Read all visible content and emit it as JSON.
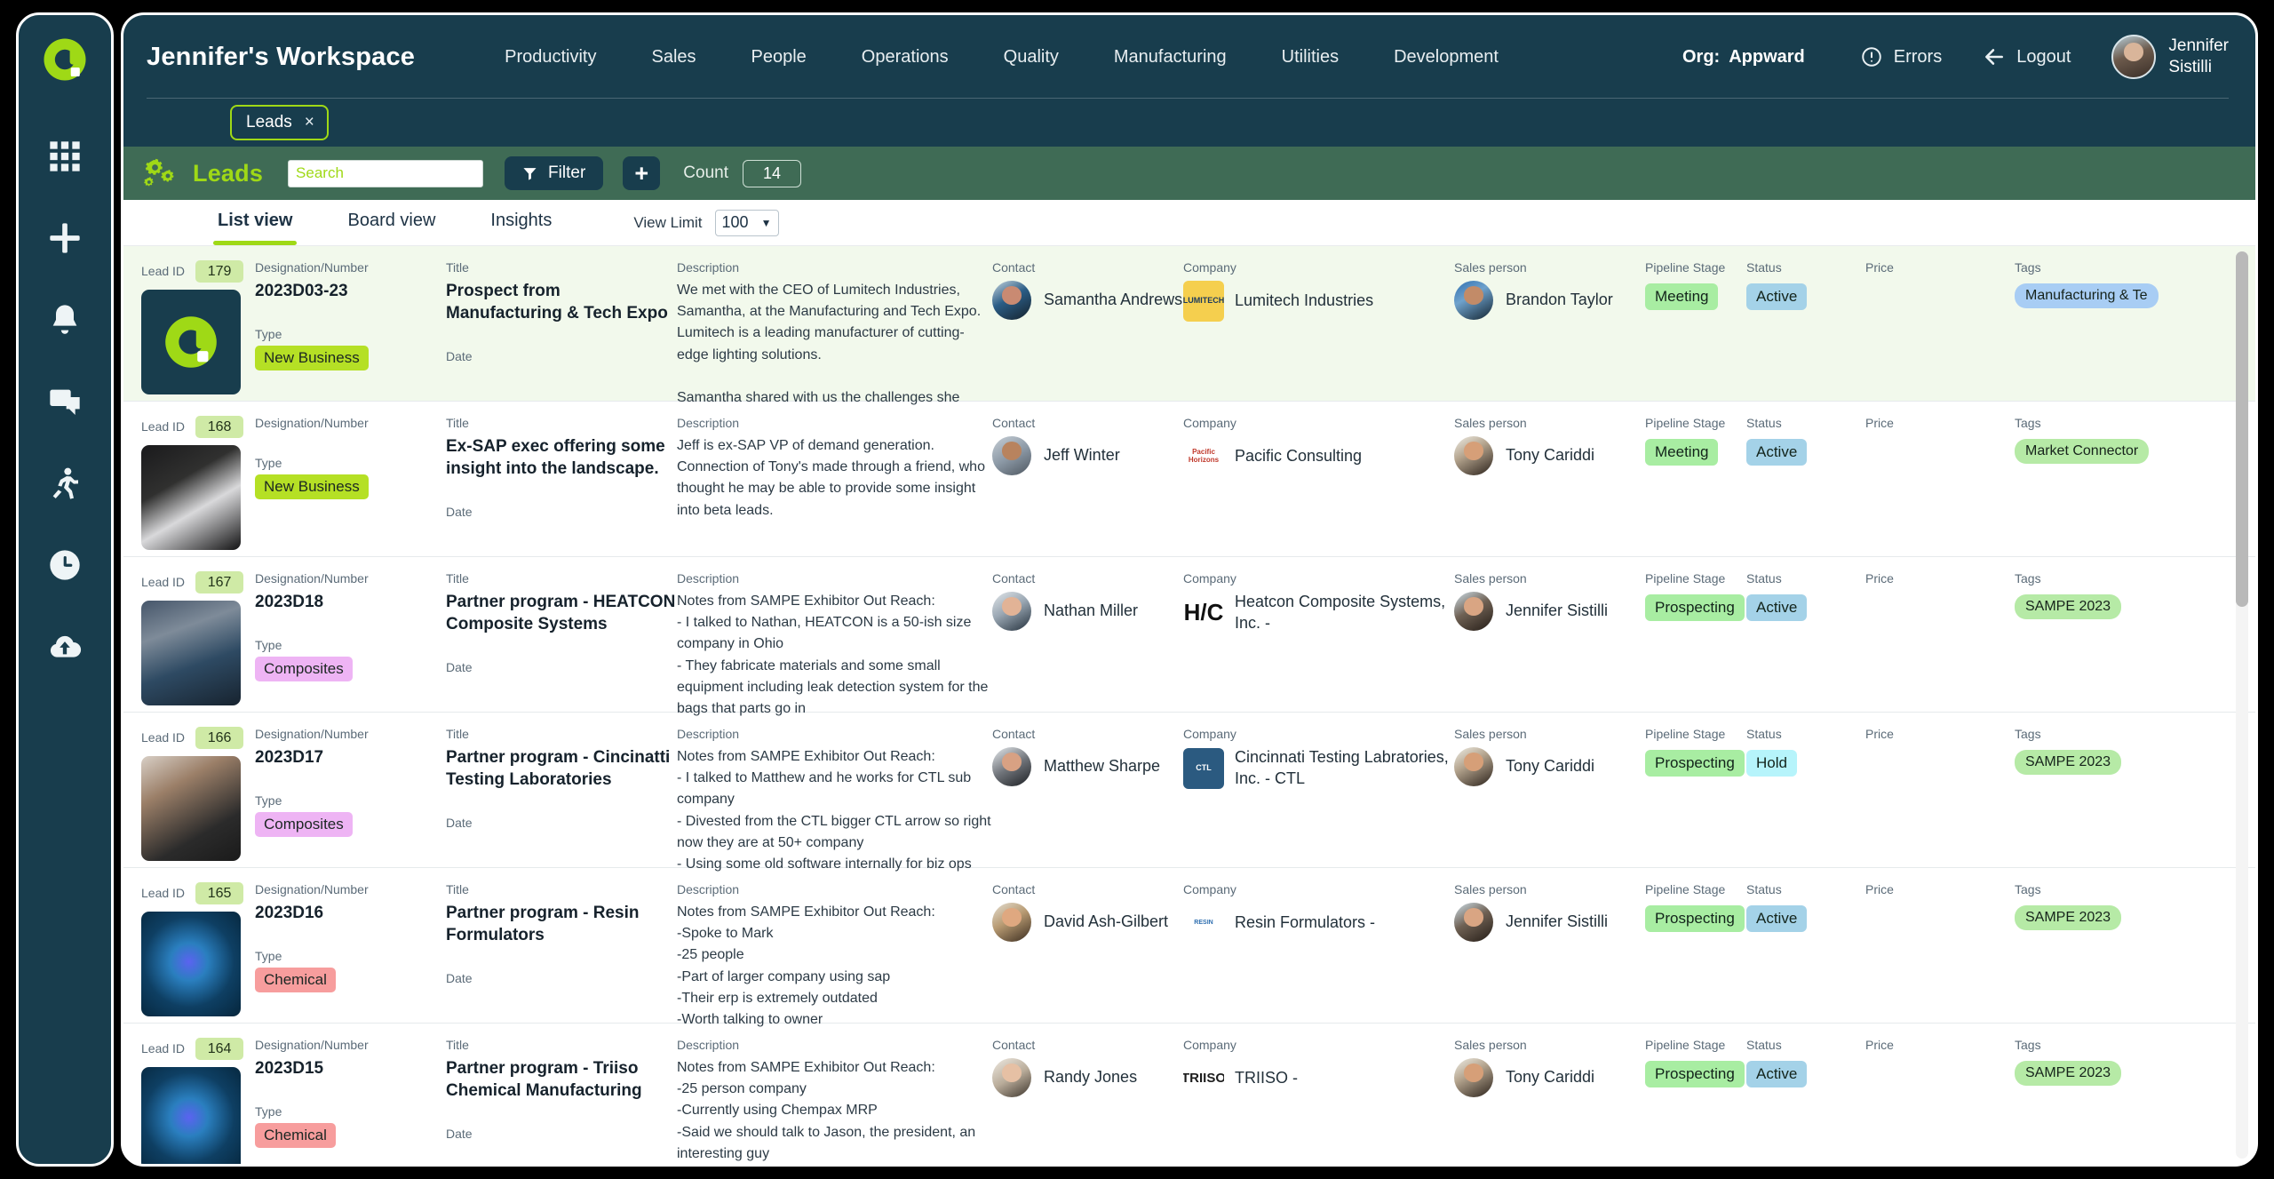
{
  "rail": {
    "logo": "appward-logo-icon",
    "items": [
      {
        "icon": "grid-apps-icon",
        "name": "apps"
      },
      {
        "icon": "plus-icon",
        "name": "add"
      },
      {
        "icon": "bell-icon",
        "name": "notifications"
      },
      {
        "icon": "chat-icon",
        "name": "messages"
      },
      {
        "icon": "runner-icon",
        "name": "activity"
      },
      {
        "icon": "clock-icon",
        "name": "time"
      },
      {
        "icon": "cloud-upload-icon",
        "name": "upload"
      }
    ]
  },
  "header": {
    "workspace_title": "Jennifer's Workspace",
    "nav": [
      "Productivity",
      "Sales",
      "People",
      "Operations",
      "Quality",
      "Manufacturing",
      "Utilities",
      "Development"
    ],
    "org_label": "Org:",
    "org_value": "Appward",
    "errors_label": "Errors",
    "logout_label": "Logout",
    "user_first": "Jennifer",
    "user_last": "Sistilli"
  },
  "tabbar": {
    "open_tab": "Leads",
    "close_glyph": "×"
  },
  "toolbar": {
    "title": "Leads",
    "search_placeholder": "Search",
    "search_value": "",
    "filter_label": "Filter",
    "add_label": "+",
    "count_label": "Count",
    "count_value": "14"
  },
  "viewtabs": {
    "tabs": [
      "List view",
      "Board view",
      "Insights"
    ],
    "active": "List view",
    "view_limit_label": "View Limit",
    "view_limit_value": "100",
    "view_limit_options": [
      "100"
    ]
  },
  "columns": {
    "lead_id": "Lead ID",
    "designation": "Designation/Number",
    "type": "Type",
    "title": "Title",
    "date": "Date",
    "description": "Description",
    "contact": "Contact",
    "company": "Company",
    "sales_person": "Sales person",
    "pipeline_stage": "Pipeline Stage",
    "status": "Status",
    "price": "Price",
    "tags": "Tags"
  },
  "rows": [
    {
      "lead_id": "179",
      "designation": "2023D03-23",
      "type": "New Business",
      "type_class": "pill-new",
      "thumb_class": "logo",
      "title": "Prospect from Manufacturing & Tech Expo",
      "date": "",
      "description": "We met with the CEO of Lumitech Industries, Samantha, at the Manufacturing and Tech Expo. Lumitech is a leading manufacturer of cutting-edge lighting solutions.\n\nSamantha shared with us the challenges she",
      "contact": "Samantha Andrews",
      "contact_av": "av-sam",
      "company": "Lumitech Industries",
      "company_logo_text": "LUMITECH",
      "company_logo_class": "lumi",
      "sales_person": "Brandon Taylor",
      "sales_av": "av-brandon",
      "pipeline_stage": "Meeting",
      "stage_class": "b-green",
      "status": "Active",
      "status_class": "b-blue",
      "price": "",
      "tag": "Manufacturing & Te",
      "tag_class": "t-blue",
      "highlight": true
    },
    {
      "lead_id": "168",
      "designation": "",
      "type": "New Business",
      "type_class": "pill-new",
      "thumb_class": "ph1",
      "title": "Ex-SAP exec offering some insight into the landscape.",
      "date": "",
      "description": "Jeff is ex-SAP VP of demand generation. Connection of Tony's made through a friend, who thought he may be able to provide some insight into beta leads.",
      "contact": "Jeff Winter",
      "contact_av": "av-jeff",
      "company": "Pacific Consulting",
      "company_logo_text": "Pacific Horizons",
      "company_logo_class": "pac",
      "sales_person": "Tony Cariddi",
      "sales_av": "av-tony",
      "pipeline_stage": "Meeting",
      "stage_class": "b-green",
      "status": "Active",
      "status_class": "b-blue",
      "price": "",
      "tag": "Market Connector",
      "tag_class": "t-green",
      "highlight": false
    },
    {
      "lead_id": "167",
      "designation": "2023D18",
      "type": "Composites",
      "type_class": "pill-comp",
      "thumb_class": "ph2",
      "title": "Partner program - HEATCON Composite Systems",
      "date": "",
      "description": "Notes from SAMPE Exhibitor Out Reach:\n- I talked to Nathan, HEATCON is a 50-ish size company in Ohio\n- They fabricate materials and some small equipment including leak detection system for the bags that parts go in",
      "contact": "Nathan Miller",
      "contact_av": "av-nat",
      "company": "Heatcon Composite Systems, Inc. -",
      "company_logo_text": "H/C",
      "company_logo_class": "hc",
      "sales_person": "Jennifer Sistilli",
      "sales_av": "av-jen",
      "pipeline_stage": "Prospecting",
      "stage_class": "b-green",
      "status": "Active",
      "status_class": "b-blue",
      "price": "",
      "tag": "SAMPE 2023",
      "tag_class": "t-green",
      "highlight": false
    },
    {
      "lead_id": "166",
      "designation": "2023D17",
      "type": "Composites",
      "type_class": "pill-comp",
      "thumb_class": "ph3",
      "title": "Partner program - Cincinatti Testing Laboratories",
      "date": "",
      "description": "Notes from SAMPE Exhibitor Out Reach:\n- I talked to Matthew and he works for CTL sub company\n- Divested from the CTL bigger CTL arrow so right now they are at 50+ company\n- Using some old software internally for biz ops",
      "contact": "Matthew Sharpe",
      "contact_av": "av-mat",
      "company": "Cincinnati Testing Labratories, Inc. - CTL",
      "company_logo_text": "CTL",
      "company_logo_class": "ctl",
      "sales_person": "Tony Cariddi",
      "sales_av": "av-tony",
      "pipeline_stage": "Prospecting",
      "stage_class": "b-green",
      "status": "Hold",
      "status_class": "b-cyan",
      "price": "",
      "tag": "SAMPE 2023",
      "tag_class": "t-green",
      "highlight": false
    },
    {
      "lead_id": "165",
      "designation": "2023D16",
      "type": "Chemical",
      "type_class": "pill-chem",
      "thumb_class": "ph4",
      "title": "Partner program - Resin Formulators",
      "date": "",
      "description": "Notes from SAMPE Exhibitor Out Reach:\n-Spoke to Mark\n-25 people\n-Part of larger company using sap\n-Their erp is extremely outdated\n-Worth talking to owner",
      "contact": "David Ash-Gilbert",
      "contact_av": "av-dav",
      "company": "Resin Formulators -",
      "company_logo_text": "RESIN",
      "company_logo_class": "res",
      "sales_person": "Jennifer Sistilli",
      "sales_av": "av-jen",
      "pipeline_stage": "Prospecting",
      "stage_class": "b-green",
      "status": "Active",
      "status_class": "b-blue",
      "price": "",
      "tag": "SAMPE 2023",
      "tag_class": "t-green",
      "highlight": false
    },
    {
      "lead_id": "164",
      "designation": "2023D15",
      "type": "Chemical",
      "type_class": "pill-chem",
      "thumb_class": "ph4",
      "title": "Partner program - Triiso Chemical Manufacturing",
      "date": "",
      "description": "Notes from SAMPE Exhibitor Out Reach:\n-25 person company\n-Currently using Chempax MRP\n-Said we should talk to Jason, the president, an interesting guy",
      "contact": "Randy Jones",
      "contact_av": "av-ran",
      "company": "TRIISO -",
      "company_logo_text": "TRIISO",
      "company_logo_class": "tri",
      "sales_person": "Tony Cariddi",
      "sales_av": "av-tony",
      "pipeline_stage": "Prospecting",
      "stage_class": "b-green",
      "status": "Active",
      "status_class": "b-blue",
      "price": "",
      "tag": "SAMPE 2023",
      "tag_class": "t-green",
      "highlight": false
    }
  ],
  "colors": {
    "brand_dark": "#183d4d",
    "brand_green": "#9fd916",
    "toolbar_green": "#3f6b55",
    "row_highlight": "#f2f9ec"
  }
}
